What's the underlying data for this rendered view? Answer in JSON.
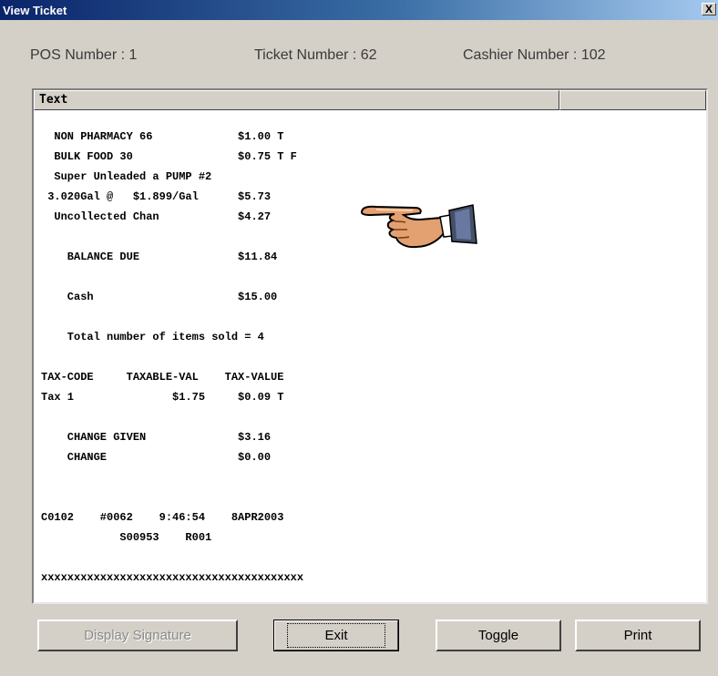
{
  "window": {
    "title": "View Ticket",
    "close_label": "X"
  },
  "info": {
    "pos": "POS Number : 1",
    "ticket": "Ticket Number : 62",
    "cashier": "Cashier Number : 102"
  },
  "grid": {
    "header": "Text",
    "lines": [
      "  NON PHARMACY 66             $1.00 T",
      "  BULK FOOD 30                $0.75 T F",
      "  Super Unleaded a PUMP #2",
      " 3.020Gal @   $1.899/Gal      $5.73",
      "  Uncollected Chan            $4.27",
      "",
      "    BALANCE DUE               $11.84",
      "",
      "    Cash                      $15.00",
      "",
      "    Total number of items sold = 4",
      "",
      "TAX-CODE     TAXABLE-VAL    TAX-VALUE",
      "Tax 1               $1.75     $0.09 T",
      "",
      "    CHANGE GIVEN              $3.16",
      "    CHANGE                    $0.00",
      "",
      "",
      "C0102    #0062    9:46:54    8APR2003",
      "            S00953    R001",
      "",
      "xxxxxxxxxxxxxxxxxxxxxxxxxxxxxxxxxxxxxxxx"
    ]
  },
  "buttons": {
    "display_signature": "Display Signature",
    "exit": "Exit",
    "toggle": "Toggle",
    "print": "Print"
  },
  "icons": {
    "pointer": "pointing-hand-icon"
  }
}
